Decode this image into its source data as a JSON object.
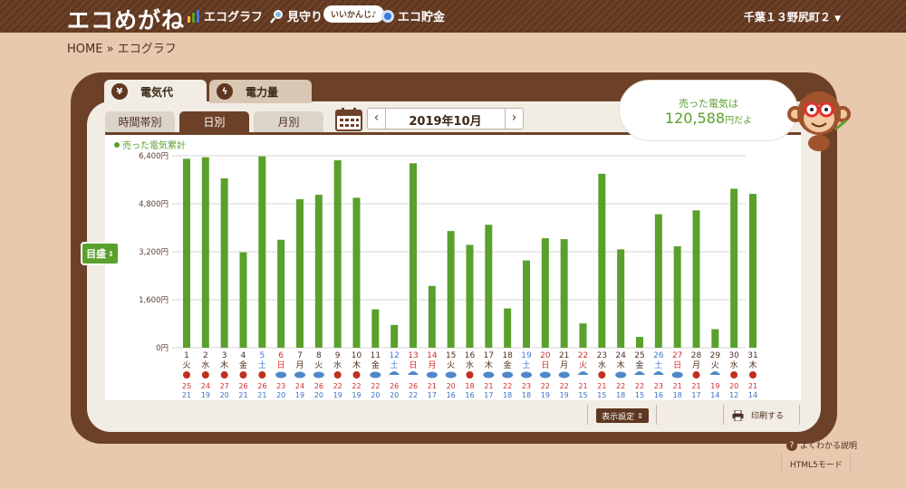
{
  "app": {
    "logo": "エコめがね",
    "nav": [
      {
        "label": "エコグラフ",
        "icon": "bar-chart-icon"
      },
      {
        "label": "見守り",
        "icon": "magnifier-icon"
      },
      {
        "label": "エコ貯金",
        "icon": "piggy-bank-icon"
      }
    ],
    "bubble": "いいかんじ♪",
    "region": "千葉１３野尻町２"
  },
  "breadcrumb": {
    "home": "HOME",
    "sep": "»",
    "current": "エコグラフ"
  },
  "tabs": {
    "main": [
      {
        "label": "電気代",
        "icon": "yen-icon"
      },
      {
        "label": "電力量",
        "icon": "lightning-icon"
      }
    ],
    "sub": [
      "時間帯別",
      "日別",
      "月別"
    ]
  },
  "date_nav": {
    "prev": "‹",
    "label": "2019年10月",
    "next": "›"
  },
  "sold_box": {
    "line1": "売った電気は",
    "amount": "120,588",
    "unit": "円だよ"
  },
  "goal_button": {
    "label": "目盛"
  },
  "display_settings": {
    "label": "表示設定"
  },
  "print": {
    "label": "印刷する"
  },
  "help": {
    "label": "よくわかる説明"
  },
  "html5_mode": {
    "label": "HTML5モード"
  },
  "colors": {
    "bar": "#5aa02c",
    "brown": "#6d4128",
    "saturday": "#3d7ad6",
    "sunday": "#d42a2a"
  },
  "chart_data": {
    "type": "bar",
    "legend": "売った電気累計",
    "ylim": [
      0,
      6400
    ],
    "yticks": [
      "0円",
      "1,600円",
      "3,200円",
      "4,800円",
      "6,400円"
    ],
    "ytick_values": [
      0,
      1600,
      3200,
      4800,
      6400
    ],
    "categories": [
      "1",
      "2",
      "3",
      "4",
      "5",
      "6",
      "7",
      "8",
      "9",
      "10",
      "11",
      "12",
      "13",
      "14",
      "15",
      "16",
      "17",
      "18",
      "19",
      "20",
      "21",
      "22",
      "23",
      "24",
      "25",
      "26",
      "27",
      "28",
      "29",
      "30",
      "31"
    ],
    "weekdays": [
      "火",
      "水",
      "木",
      "金",
      "土",
      "日",
      "月",
      "火",
      "水",
      "木",
      "金",
      "土",
      "日",
      "月",
      "火",
      "水",
      "木",
      "金",
      "土",
      "日",
      "月",
      "火",
      "水",
      "木",
      "金",
      "土",
      "日",
      "月",
      "火",
      "水",
      "木"
    ],
    "day_colors": [
      "n",
      "n",
      "n",
      "n",
      "sat",
      "sun",
      "n",
      "n",
      "n",
      "n",
      "n",
      "sat",
      "sun",
      "sun",
      "n",
      "n",
      "n",
      "n",
      "sat",
      "sun",
      "n",
      "sun",
      "n",
      "n",
      "n",
      "sat",
      "sun",
      "n",
      "n",
      "n",
      "n"
    ],
    "values": [
      6300,
      6350,
      5650,
      3180,
      6380,
      3600,
      4950,
      5100,
      6250,
      5000,
      1280,
      760,
      6150,
      2060,
      3890,
      3430,
      4100,
      1310,
      2910,
      3650,
      3620,
      810,
      5800,
      3280,
      360,
      4450,
      3380,
      4580,
      620,
      5300,
      5130
    ],
    "weather": [
      "sun",
      "sun",
      "sun",
      "sun",
      "sun",
      "cloud",
      "cloud",
      "cloud",
      "sun",
      "sun",
      "cloud",
      "rain",
      "rain",
      "cloud",
      "cloud",
      "sun",
      "cloud",
      "cloud",
      "cloud",
      "cloud",
      "cloud",
      "rain",
      "sun",
      "cloud",
      "rain",
      "rain",
      "cloud",
      "sun",
      "rain",
      "sun",
      "sun"
    ],
    "temp_high": [
      25,
      24,
      27,
      26,
      26,
      23,
      24,
      26,
      22,
      22,
      22,
      26,
      26,
      21,
      20,
      18,
      21,
      22,
      23,
      22,
      22,
      21,
      21,
      22,
      22,
      23,
      21,
      21,
      19,
      20,
      21
    ],
    "temp_low": [
      21,
      19,
      20,
      21,
      21,
      20,
      19,
      20,
      19,
      19,
      20,
      20,
      22,
      17,
      16,
      16,
      17,
      18,
      18,
      19,
      19,
      15,
      15,
      18,
      15,
      16,
      18,
      17,
      14,
      12,
      14
    ]
  }
}
